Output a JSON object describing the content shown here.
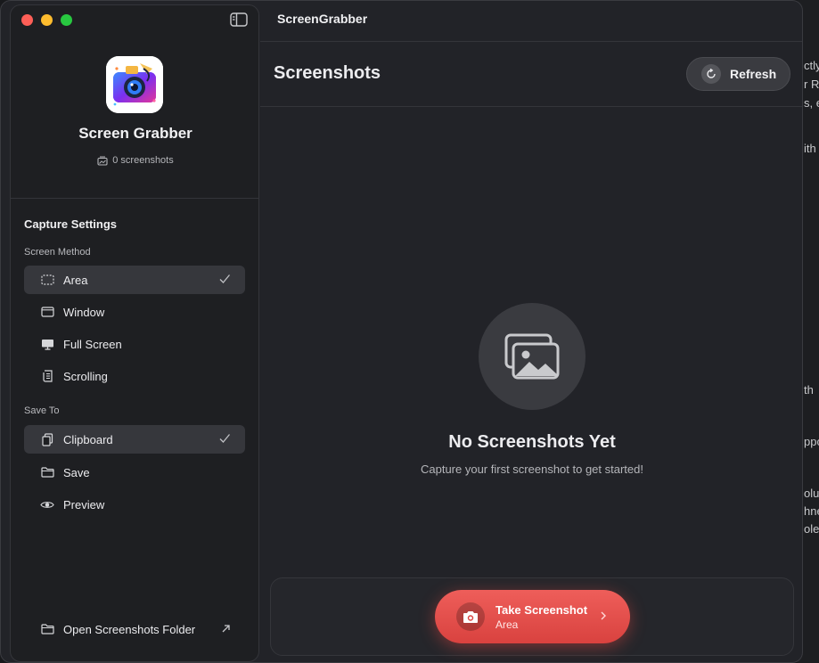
{
  "window": {
    "title": "ScreenGrabber"
  },
  "sidebar": {
    "app_name": "Screen Grabber",
    "screenshot_count": "0 screenshots",
    "capture_settings_title": "Capture Settings",
    "screen_method_label": "Screen Method",
    "screen_methods": [
      {
        "label": "Area",
        "icon": "area-icon",
        "selected": true
      },
      {
        "label": "Window",
        "icon": "window-icon",
        "selected": false
      },
      {
        "label": "Full Screen",
        "icon": "display-icon",
        "selected": false
      },
      {
        "label": "Scrolling",
        "icon": "scroll-icon",
        "selected": false
      }
    ],
    "save_to_label": "Save To",
    "save_options": [
      {
        "label": "Clipboard",
        "icon": "clipboard-icon",
        "selected": true
      },
      {
        "label": "Save",
        "icon": "folder-icon",
        "selected": false
      },
      {
        "label": "Preview",
        "icon": "eye-icon",
        "selected": false
      }
    ],
    "open_folder_label": "Open Screenshots Folder"
  },
  "main": {
    "page_title": "Screenshots",
    "refresh_label": "Refresh",
    "empty_title": "No Screenshots Yet",
    "empty_subtitle": "Capture your first screenshot to get started!",
    "take_button": {
      "label": "Take Screenshot",
      "mode": "Area"
    }
  },
  "background_text": [
    "ctly",
    "r Re",
    "s, e",
    "ith",
    "th",
    "ppo",
    "olu",
    "hne",
    "ole"
  ],
  "colors": {
    "accent": "#e24b47",
    "sidebar_bg": "#1e1f22",
    "main_bg": "#222328",
    "selected_bg": "#36373c"
  }
}
